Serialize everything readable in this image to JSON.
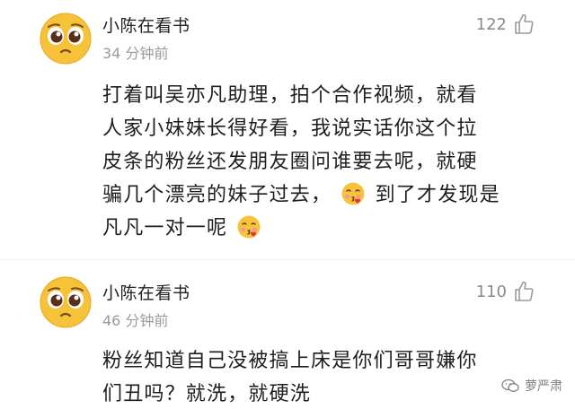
{
  "comments": [
    {
      "username": "小陈在看书",
      "timestamp": "34 分钟前",
      "likes": "122",
      "lines": [
        "打着叫吴亦凡助理，拍个合作视频，就看",
        "人家小妹妹长得好看，我说实话你这个拉",
        "皮条的粉丝还发朋友圈问谁要去呢，就硬",
        "骗几个漂亮的妹子过去，",
        "到了才发现是",
        "凡凡一对一呢"
      ]
    },
    {
      "username": "小陈在看书",
      "timestamp": "46 分钟前",
      "likes": "110",
      "lines": [
        "粉丝知道自己没被搞上床是你们哥哥嫌你",
        "们丑吗？就洗，就硬洗"
      ]
    }
  ],
  "watermark": {
    "text": "萝严肃",
    "icon": "wechat-icon"
  },
  "icons": {
    "avatar": "pleading-face-avatar",
    "like": "thumbs-up-icon",
    "emoji": "blushing-kiss-emoji"
  },
  "colors": {
    "avatar_face": "#f6c23a",
    "text": "#1e1e1e",
    "muted": "#9a9a9a"
  }
}
